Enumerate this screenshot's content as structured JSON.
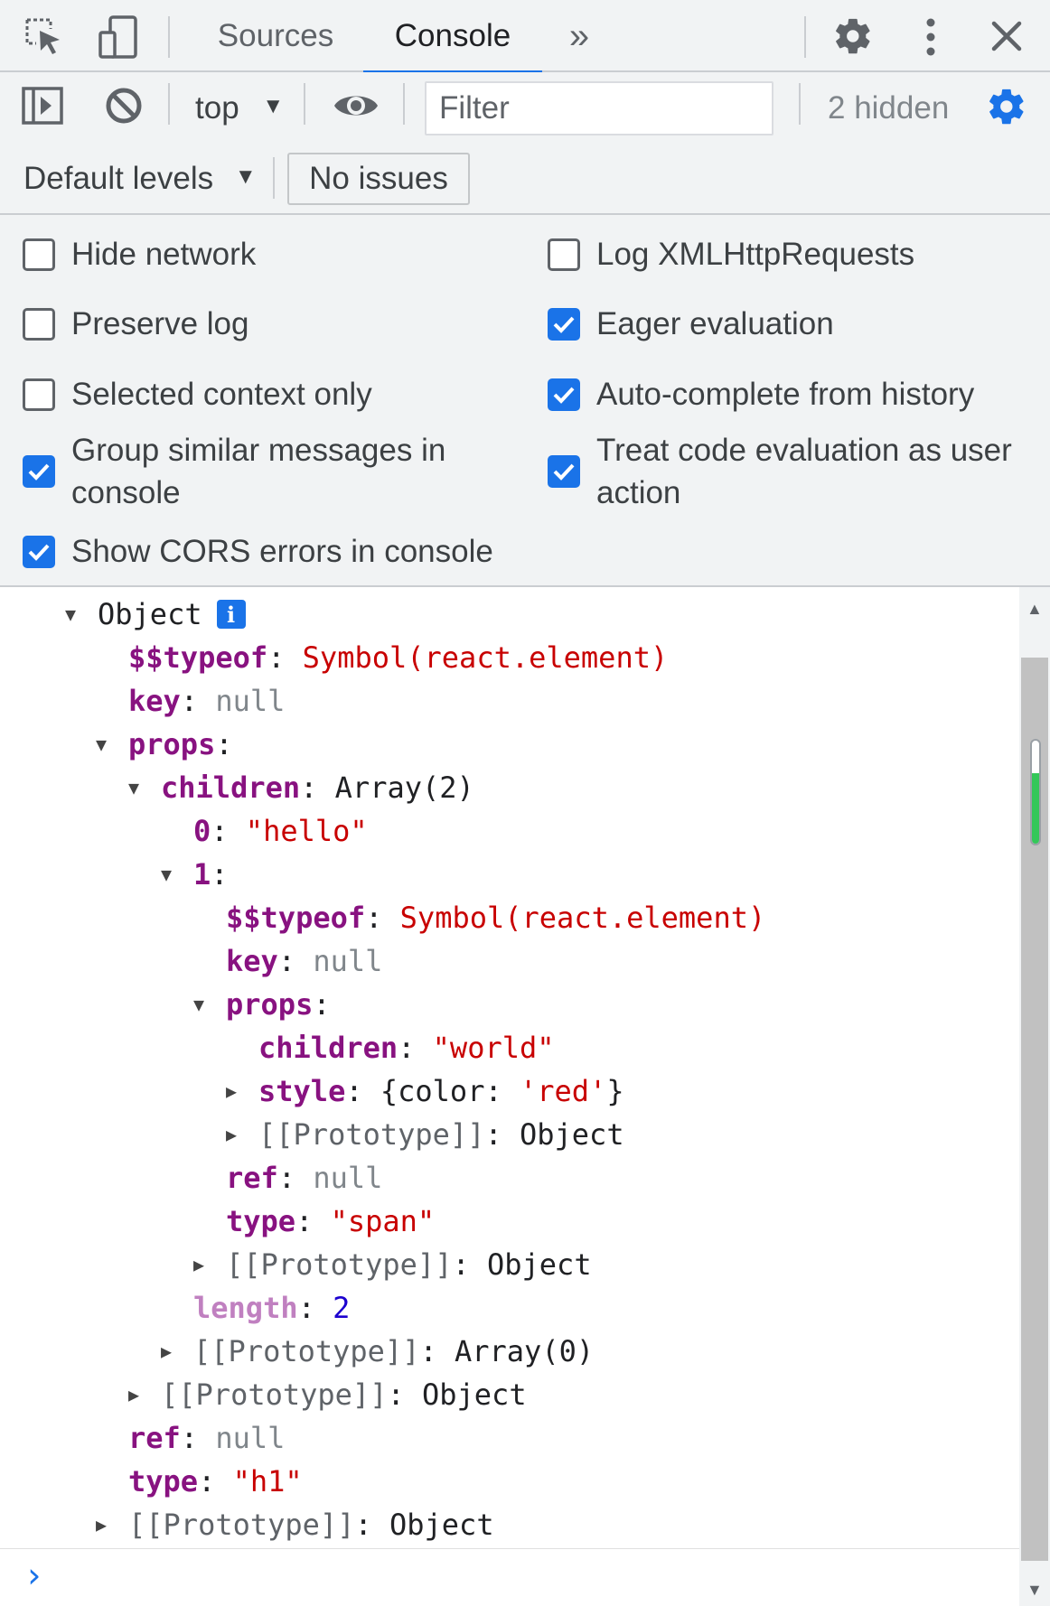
{
  "tabs": {
    "sources": "Sources",
    "console": "Console",
    "more": "»"
  },
  "toolbar": {
    "context": "top",
    "filter_placeholder": "Filter",
    "hidden_count": "2 hidden",
    "levels": "Default levels",
    "issues": "No issues"
  },
  "settings": {
    "hide_network": "Hide network",
    "preserve_log": "Preserve log",
    "selected_context": "Selected context only",
    "group_similar": "Group similar messages in console",
    "show_cors": "Show CORS errors in console",
    "log_xhr": "Log XMLHttpRequests",
    "eager_eval": "Eager evaluation",
    "autocomplete": "Auto-complete from history",
    "treat_eval": "Treat code evaluation as user action"
  },
  "console": {
    "root": "Object",
    "typeof_key": "$$typeof",
    "typeof_val": "Symbol(react.element)",
    "key_key": "key",
    "null_val": "null",
    "props_key": "props",
    "children_key": "children",
    "children_val": "Array(2)",
    "idx0": "0",
    "hello": "\"hello\"",
    "idx1": "1",
    "world": "\"world\"",
    "style_key": "style",
    "style_val_open": "{color: ",
    "style_val_red": "'red'",
    "style_val_close": "}",
    "proto_key": "[[Prototype]]",
    "object_val": "Object",
    "array0_val": "Array(0)",
    "ref_key": "ref",
    "type_key": "type",
    "span_val": "\"span\"",
    "length_key": "length",
    "length_val": "2",
    "h1_val": "\"h1\""
  },
  "prompt": "›"
}
